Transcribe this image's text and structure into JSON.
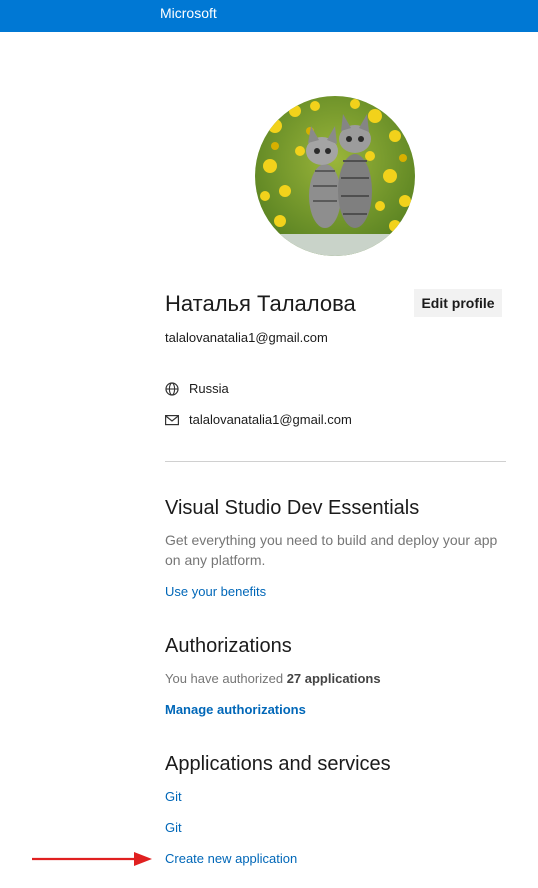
{
  "header": {
    "brand": "Microsoft",
    "background_color": "#0078d4"
  },
  "profile": {
    "avatar_alt": "Two kittens among yellow flowers",
    "name": "Наталья Талалова",
    "edit_label": "Edit profile",
    "email": "talalovanatalia1@gmail.com",
    "location_icon": "globe-icon",
    "location": "Russia",
    "contact_icon": "mail-icon",
    "contact_email": "talalovanatalia1@gmail.com"
  },
  "dev_essentials": {
    "title": "Visual Studio Dev Essentials",
    "description": "Get everything you need to build and deploy your app on any platform.",
    "link": "Use your benefits"
  },
  "authorizations": {
    "title": "Authorizations",
    "text_prefix": "You have authorized",
    "count_text": "27 applications",
    "link": "Manage authorizations"
  },
  "apps": {
    "title": "Applications and services",
    "items": [
      {
        "label": "Git"
      },
      {
        "label": "Git"
      }
    ],
    "create_link": "Create new application"
  },
  "annotation": {
    "arrow_color": "#e02020"
  },
  "colors": {
    "link": "#0067b8",
    "muted": "#767676"
  }
}
